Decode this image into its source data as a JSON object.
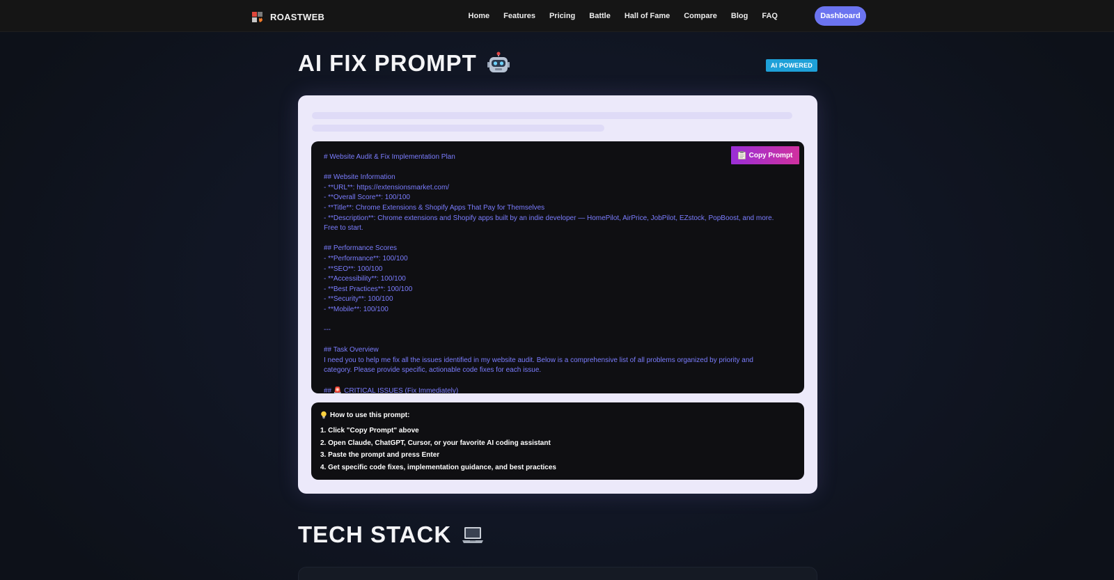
{
  "navbar": {
    "brand_name": "ROASTWEB",
    "links": [
      "Home",
      "Features",
      "Pricing",
      "Battle",
      "Hall of Fame",
      "Compare",
      "Blog",
      "FAQ"
    ],
    "dashboard_label": "Dashboard"
  },
  "ai_fix": {
    "title": "AI FIX PROMPT",
    "badge": "AI POWERED",
    "copy_label": "Copy Prompt",
    "prompt_lines": [
      "# Website Audit & Fix Implementation Plan",
      "",
      "## Website Information",
      "- **URL**: https://extensionsmarket.com/",
      "- **Overall Score**: 100/100",
      "- **Title**: Chrome Extensions & Shopify Apps That Pay for Themselves",
      "- **Description**: Chrome extensions and Shopify apps built by an indie developer — HomePilot, AirPrice, JobPilot, EZstock, PopBoost, and more.",
      "Free to start.",
      "",
      "## Performance Scores",
      "- **Performance**: 100/100",
      "- **SEO**: 100/100",
      "- **Accessibility**: 100/100",
      "- **Best Practices**: 100/100",
      "- **Security**: 100/100",
      "- **Mobile**: 100/100",
      "",
      "---",
      "",
      "## Task Overview",
      "I need you to help me fix all the issues identified in my website audit. Below is a comprehensive list of all problems organized by priority and",
      "category. Please provide specific, actionable code fixes for each issue.",
      "",
      "## 🚨 CRITICAL ISSUES (Fix Immediately)"
    ],
    "how_to": {
      "title": "How to use this prompt:",
      "steps": [
        "1. Click \"Copy Prompt\" above",
        "2. Open Claude, ChatGPT, Cursor, or your favorite AI coding assistant",
        "3. Paste the prompt and press Enter",
        "4. Get specific code fixes, implementation guidance, and best practices"
      ]
    }
  },
  "tech_stack": {
    "title": "TECH STACK"
  },
  "icons": {
    "brand": "fire-logo-icon",
    "ai_title": "robot-icon",
    "copy": "clipboard-icon",
    "how_to": "lightbulb-icon",
    "tech_title": "laptop-icon"
  },
  "colors": {
    "accent": "#6b74f0",
    "badge": "#1ea0d8",
    "prompt_text": "#7b7dff",
    "copy_gradient_start": "#9a2fd6",
    "copy_gradient_end": "#d0309f"
  }
}
